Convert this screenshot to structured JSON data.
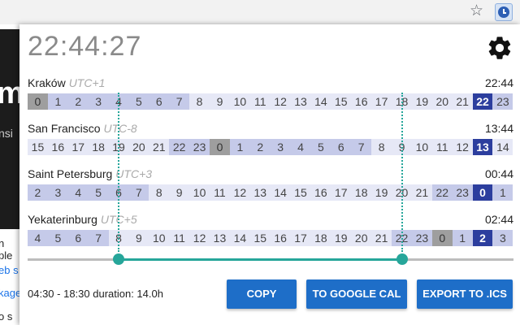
{
  "browser": {
    "star_icon": "star-icon",
    "extension_icon": "clock-icon"
  },
  "background_page": {
    "heading_letter": "m",
    "subtext": "nsi",
    "lines": [
      "n ple",
      "eb s",
      "kage",
      "o s"
    ]
  },
  "popup": {
    "current_time": "22:44:27",
    "zones": [
      {
        "name": "Kraków",
        "offset": "UTC+1",
        "time": "22:44",
        "hours": [
          0,
          1,
          2,
          3,
          4,
          5,
          6,
          7,
          8,
          9,
          10,
          11,
          12,
          13,
          14,
          15,
          16,
          17,
          18,
          19,
          20,
          21,
          22,
          23
        ],
        "current": 22
      },
      {
        "name": "San Francisco",
        "offset": "UTC-8",
        "time": "13:44",
        "hours": [
          15,
          16,
          17,
          18,
          19,
          20,
          21,
          22,
          23,
          0,
          1,
          2,
          3,
          4,
          5,
          6,
          7,
          8,
          9,
          10,
          11,
          12,
          13,
          14
        ],
        "current": 13
      },
      {
        "name": "Saint Petersburg",
        "offset": "UTC+3",
        "time": "00:44",
        "hours": [
          2,
          3,
          4,
          5,
          6,
          7,
          8,
          9,
          10,
          11,
          12,
          13,
          14,
          15,
          16,
          17,
          18,
          19,
          20,
          21,
          22,
          23,
          0,
          1
        ],
        "current": 0
      },
      {
        "name": "Yekaterinburg",
        "offset": "UTC+5",
        "time": "02:44",
        "hours": [
          4,
          5,
          6,
          7,
          8,
          9,
          10,
          11,
          12,
          13,
          14,
          15,
          16,
          17,
          18,
          19,
          20,
          21,
          22,
          23,
          0,
          1,
          2,
          3
        ],
        "current": 2
      }
    ],
    "selection": {
      "start_index": 4.5,
      "end_index": 18.5
    },
    "range_text": "04:30 - 18:30 duration: 14.0h",
    "buttons": {
      "copy": "COPY",
      "google": "TO GOOGLE CAL",
      "ics": "EXPORT TO .ICS"
    },
    "colors": {
      "accent": "#26a69a",
      "button": "#1e6ec8",
      "current_hour": "#2c3e9e",
      "night": "#c5cae9",
      "day": "#e6e8f6",
      "midnight": "#9e9e9e"
    }
  }
}
